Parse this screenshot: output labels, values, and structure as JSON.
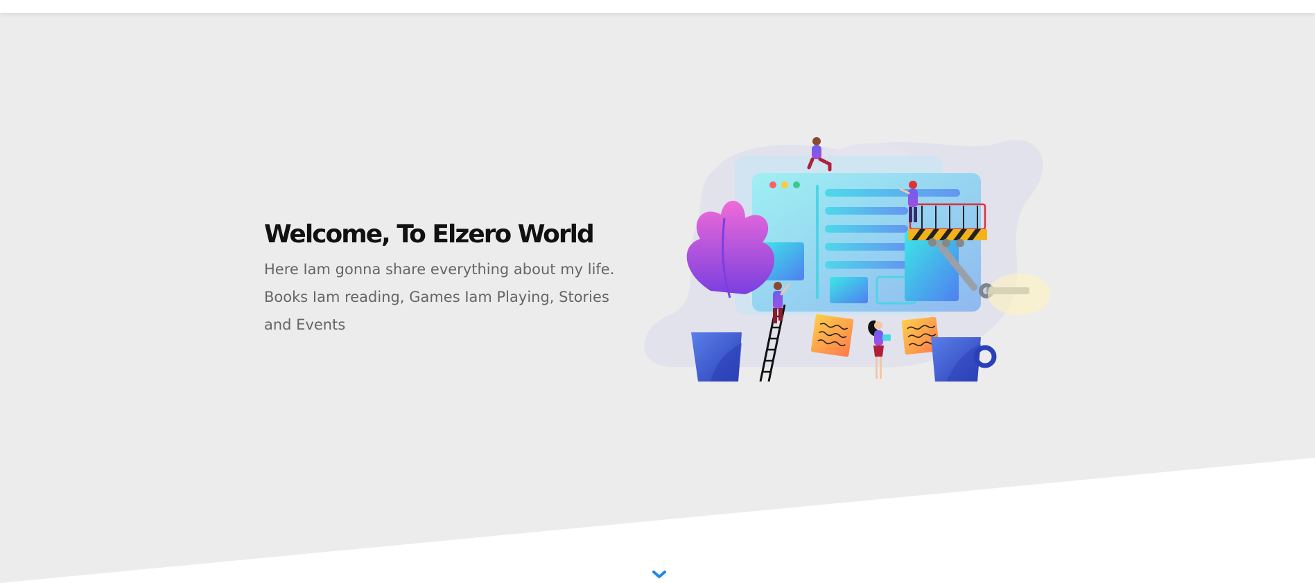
{
  "hero": {
    "title": "Welcome, To Elzero World",
    "description": "Here Iam gonna share everything about my life. Books Iam reading, Games Iam Playing, Stories and Events",
    "background_color": "#ececec"
  },
  "illustration": {
    "name": "web-design-illustration",
    "colors": {
      "cyan": "#3fe0e6",
      "blue": "#4f6de0",
      "purple": "#9a4fe0",
      "pink": "#e05fd0",
      "orange": "#ffa24a",
      "hazard_yellow": "#f2b21a"
    }
  },
  "scroll_indicator": {
    "icon": "chevron-down-icon",
    "color": "#1e88e5"
  }
}
